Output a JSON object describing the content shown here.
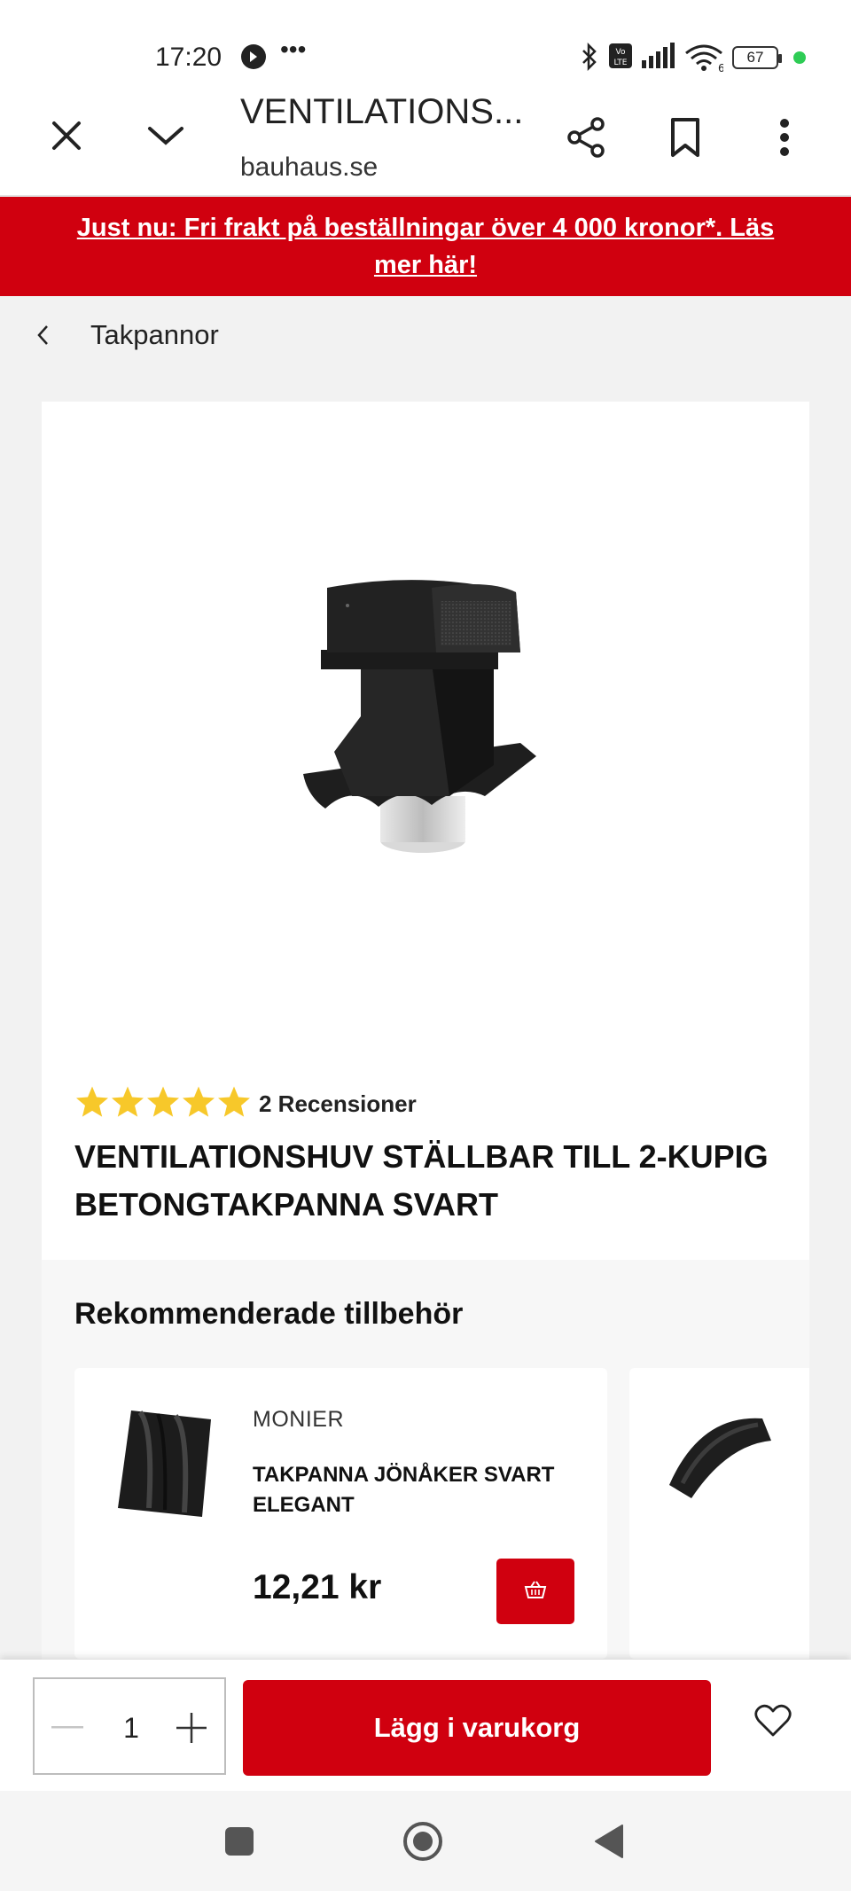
{
  "status_bar": {
    "time": "17:20",
    "extra_icon": "•••",
    "battery": "67",
    "icons": [
      "do-not-disturb-icon",
      "bluetooth-icon",
      "volte-icon",
      "signal-icon",
      "wifi-6-icon",
      "battery-icon"
    ]
  },
  "browser": {
    "title": "VENTILATIONS...",
    "domain": "bauhaus.se"
  },
  "promo": {
    "text": "Just nu: Fri frakt på beställningar över 4 000 kronor*. Läs mer här!"
  },
  "breadcrumb": {
    "label": "Takpannor"
  },
  "product": {
    "rating": 5,
    "rating_max": 5,
    "reviews": "2 Recensioner",
    "title": "VENTILATIONSHUV STÄLLBAR TILL 2-KUPIG BETONGTAKPANNA SVART"
  },
  "recommended": {
    "heading": "Rekommenderade tillbehör",
    "items": [
      {
        "brand": "MONIER",
        "name": "TAKPANNA JÖNÅKER SVART ELEGANT",
        "price": "12,21 kr"
      }
    ]
  },
  "action_bar": {
    "quantity": "1",
    "add_to_cart_label": "Lägg i varukorg"
  },
  "colors": {
    "brand_red": "#d0000f",
    "star_yellow": "#f7c82a"
  }
}
